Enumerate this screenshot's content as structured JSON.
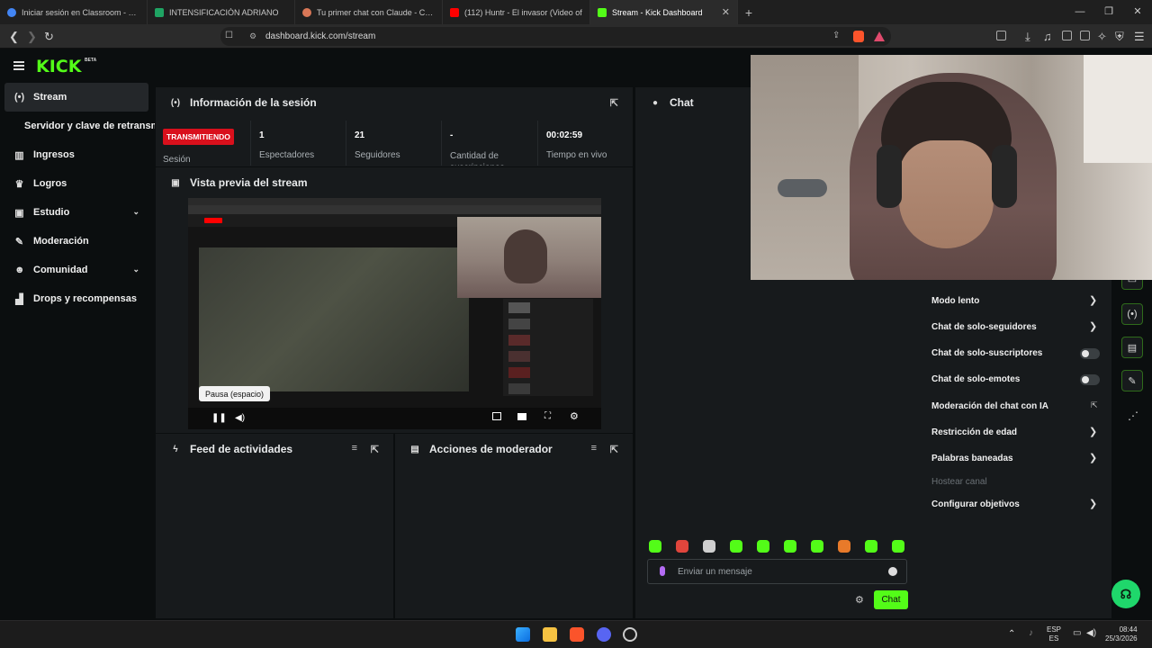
{
  "browser": {
    "tabs": [
      {
        "label": "Iniciar sesión en Classroom - Ordena",
        "color": "#4285f4"
      },
      {
        "label": "INTENSIFICACIÓN ADRIANO",
        "color": "#1fa463"
      },
      {
        "label": "Tu primer chat con Claude - Claude",
        "color": "#d97757"
      },
      {
        "label": "(112) Huntr - El invasor (Video of",
        "color": "#ff0000"
      },
      {
        "label": "Stream - Kick Dashboard",
        "color": "#53fc18"
      }
    ],
    "new_tab": "+",
    "url": "dashboard.kick.com/stream",
    "window": {
      "minimize": "—",
      "maximize": "❐",
      "close": "✕"
    },
    "tab_close": "✕"
  },
  "app": {
    "logo": "KICK",
    "beta": "BETA"
  },
  "sidebar": {
    "items": [
      {
        "label": "Stream",
        "icon": "broadcast-icon",
        "glyph": "(•)"
      },
      {
        "label": "Servidor y clave de retransmisión"
      },
      {
        "label": "Ingresos",
        "icon": "chart-icon",
        "glyph": "▥"
      },
      {
        "label": "Logros",
        "icon": "trophy-icon",
        "glyph": "♛"
      },
      {
        "label": "Estudio",
        "icon": "studio-icon",
        "glyph": "▣",
        "chevron": "⌄"
      },
      {
        "label": "Moderación",
        "icon": "wrench-icon",
        "glyph": "✎"
      },
      {
        "label": "Comunidad",
        "icon": "users-icon",
        "glyph": "☻",
        "chevron": "⌄"
      },
      {
        "label": "Drops y recompensas",
        "icon": "drops-icon",
        "glyph": "▟"
      }
    ]
  },
  "session": {
    "title": "Información de la sesión",
    "badge": "TRANSMITIENDO",
    "badge_label": "Sesión",
    "stats": [
      {
        "value": "1",
        "label": "Espectadores"
      },
      {
        "value": "21",
        "label": "Seguidores"
      },
      {
        "value": "-",
        "label": "Cantidad de suscripciones"
      },
      {
        "value": "00:02:59",
        "label": "Tiempo en vivo"
      }
    ]
  },
  "preview": {
    "title": "Vista previa del stream",
    "tooltip": "Pausa (espacio)"
  },
  "feed": {
    "title": "Feed de actividades"
  },
  "mod_actions": {
    "title": "Acciones de moderador"
  },
  "chat": {
    "title": "Chat",
    "placeholder": "Enviar un mensaje",
    "send": "Chat",
    "emote_colors": [
      "#53fc18",
      "#e0453c",
      "#cfcfcf",
      "#53fc18",
      "#53fc18",
      "#53fc18",
      "#53fc18",
      "#e87a2a",
      "#53fc18",
      "#53fc18"
    ]
  },
  "mod_menu": {
    "items": [
      {
        "label": "Modo lento",
        "control": "arrow"
      },
      {
        "label": "Chat de solo-seguidores",
        "control": "arrow"
      },
      {
        "label": "Chat de solo-suscriptores",
        "control": "toggle"
      },
      {
        "label": "Chat de solo-emotes",
        "control": "toggle"
      },
      {
        "label": "Moderación del chat con IA",
        "control": "link"
      },
      {
        "label": "Restricción de edad",
        "control": "arrow"
      },
      {
        "label": "Palabras baneadas",
        "control": "arrow"
      },
      {
        "label": "Hostear canal",
        "control": "none",
        "disabled": true
      },
      {
        "label": "Configurar objetivos",
        "control": "arrow"
      }
    ]
  },
  "taskbar": {
    "lang": "ESP",
    "lang_sub": "ES",
    "time": "08:44",
    "date": "25/3/2026"
  }
}
